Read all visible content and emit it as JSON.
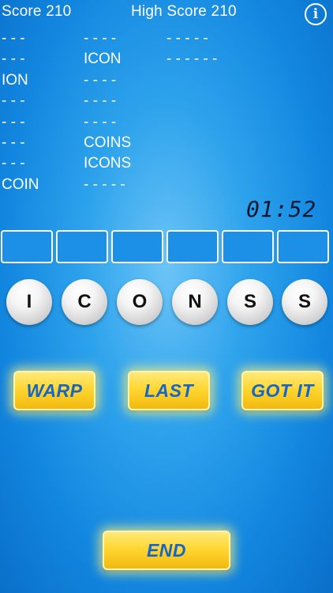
{
  "header": {
    "score_label": "Score  210",
    "high_score_label": "High Score 210",
    "info_icon_glyph": "i"
  },
  "words": {
    "col1": [
      "- - -",
      "- - -",
      "ION",
      "- - -",
      "- - -",
      "- - -",
      "- - -",
      "COIN"
    ],
    "col2": [
      "- - - -",
      "ICON",
      "- - - -",
      "- - - -",
      "- - - -",
      "COINS",
      "ICONS",
      "- - - - -"
    ],
    "col3": [
      "- - - - -",
      "- - - - - -"
    ]
  },
  "timer": "01:52",
  "answer_slots": 6,
  "letters": [
    "I",
    "C",
    "O",
    "N",
    "S",
    "S"
  ],
  "buttons": {
    "warp": "WARP",
    "last": "LAST",
    "gotit": "GOT IT",
    "end": "END"
  },
  "colors": {
    "background": "#1a8fe4",
    "button": "#ffd632",
    "button_text": "#1566c8"
  }
}
